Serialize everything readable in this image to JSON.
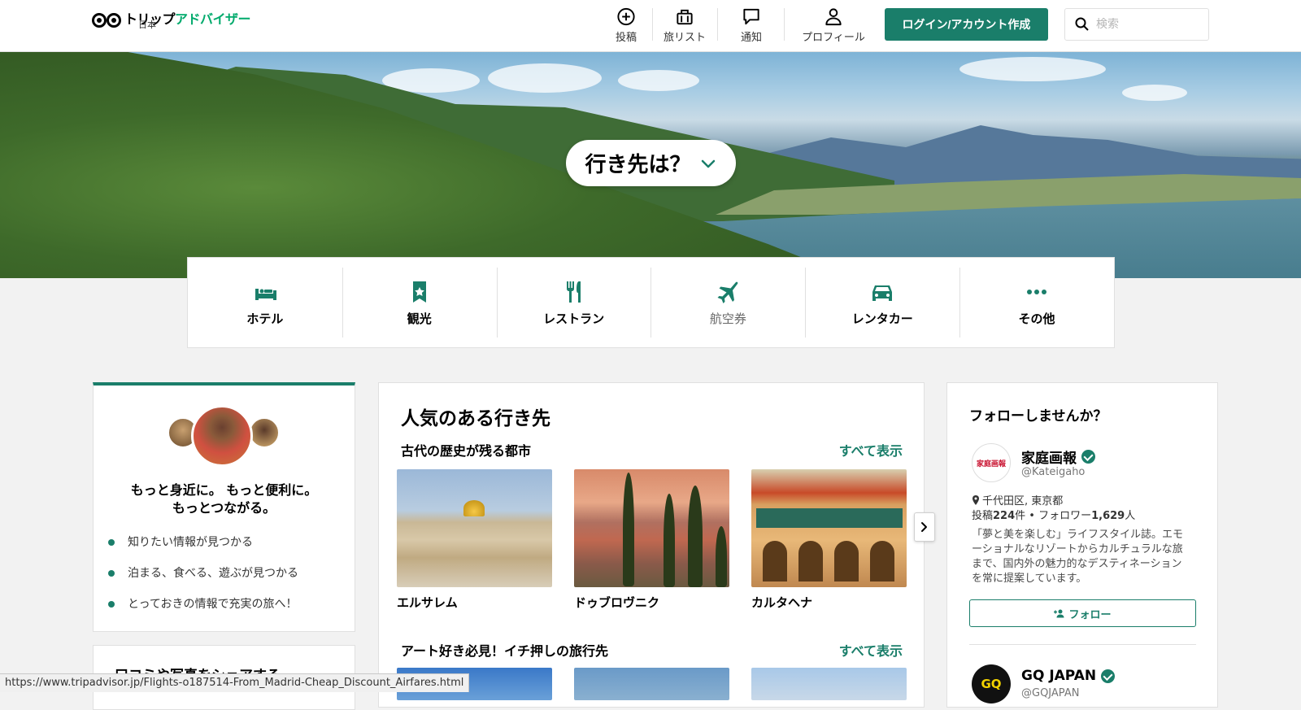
{
  "header": {
    "logo_main": "トリップ",
    "logo_accent": "アドバイザー",
    "logo_sub": "日本",
    "nav": [
      {
        "label": "投稿",
        "icon": "plus-circle-icon"
      },
      {
        "label": "旅リスト",
        "icon": "suitcase-icon"
      },
      {
        "label": "通知",
        "icon": "chat-bubble-icon"
      },
      {
        "label": "プロフィール",
        "icon": "person-icon"
      }
    ],
    "login_label": "ログイン/アカウント作成",
    "search_placeholder": "検索"
  },
  "hero": {
    "where_label": "行き先は？"
  },
  "categories": [
    {
      "label": "ホテル",
      "icon": "bed-icon"
    },
    {
      "label": "観光",
      "icon": "ticket-star-icon"
    },
    {
      "label": "レストラン",
      "icon": "fork-knife-icon"
    },
    {
      "label": "航空券",
      "icon": "airplane-icon"
    },
    {
      "label": "レンタカー",
      "icon": "car-icon"
    },
    {
      "label": "その他",
      "icon": "more-dots-icon"
    }
  ],
  "promo": {
    "title_line1": "もっと身近に。 もっと便利に。",
    "title_line2": "もっとつながる。",
    "benefits": [
      "知りたい情報が見つかる",
      "泊まる、食べる、遊ぶが見つかる",
      "とっておきの情報で充実の旅へ！"
    ],
    "share_title": "口コミや写真をシェアする"
  },
  "popular": {
    "title": "人気のある行き先",
    "sections": [
      {
        "title": "古代の歴史が残る都市",
        "see_all": "すべて表示",
        "items": [
          "エルサレム",
          "ドゥブロヴニク",
          "カルタヘナ"
        ]
      },
      {
        "title": "アート好き必見！イチ押しの旅行先",
        "see_all": "すべて表示"
      }
    ]
  },
  "follow": {
    "title": "フォローしませんか？",
    "account1": {
      "logo_text": "家庭画報",
      "name": "家庭画報",
      "handle": "@Kateigaho",
      "location": "千代田区, 東京都",
      "stats_prefix": "投稿",
      "posts": "224",
      "stats_mid": "件 • フォロワー",
      "followers": "1,629",
      "stats_suffix": "人",
      "description": "「夢と美を楽しむ」ライフスタイル誌。エモーショナルなリゾートからカルチュラルな旅まで、国内外の魅力的なデスティネーションを常に提案しています。",
      "follow_label": "フォロー"
    },
    "account2": {
      "logo_text": "GQ",
      "name": "GQ JAPAN",
      "handle": "@GQJAPAN"
    }
  },
  "status_bar": {
    "url": "https://www.tripadvisor.jp/Flights-o187514-From_Madrid-Cheap_Discount_Airfares.html"
  },
  "colors": {
    "brand_green": "#1a7e6a",
    "logo_green": "#00aa6c"
  }
}
